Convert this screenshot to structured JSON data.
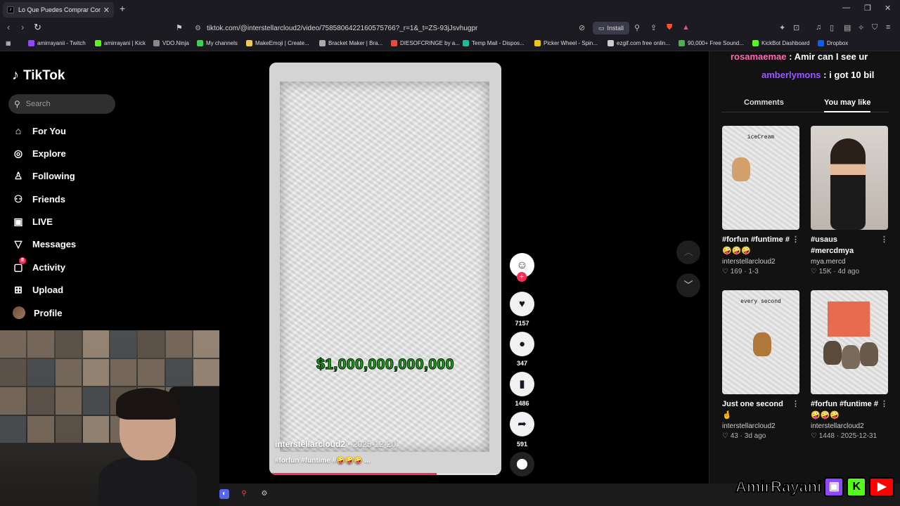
{
  "browser": {
    "tab_title": "Lo Que Puedes Comprar Con",
    "url": "tiktok.com/@interstellarcloud2/video/7585806422160575766?_r=1&_t=ZS-93jJsvhugpr",
    "install_label": "Install",
    "bookmarks": [
      {
        "label": "amirrayanii - Twitch",
        "color": "#9146ff"
      },
      {
        "label": "amirrayani | Kick",
        "color": "#53fc18"
      },
      {
        "label": "VDO.Ninja",
        "color": "#888888"
      },
      {
        "label": "My channels",
        "color": "#39d353"
      },
      {
        "label": "MakeEmoji | Create...",
        "color": "#f2c94c"
      },
      {
        "label": "Bracket Maker | Bra...",
        "color": "#aaaaaa"
      },
      {
        "label": "DIESOFCRINGE by a...",
        "color": "#e74c3c"
      },
      {
        "label": "Temp Mail - Dispos...",
        "color": "#1abc9c"
      },
      {
        "label": "Picker Wheel - Spin...",
        "color": "#f1c40f"
      },
      {
        "label": "ezgif.com free onlin...",
        "color": "#cccccc"
      },
      {
        "label": "90,000+ Free Sound...",
        "color": "#4caf50"
      },
      {
        "label": "KickBot Dashboard",
        "color": "#53fc18"
      },
      {
        "label": "Dropbox",
        "color": "#0061ff"
      }
    ]
  },
  "tiktok": {
    "logo_text": "TikTok",
    "search_placeholder": "Search",
    "nav": [
      {
        "label": "For You",
        "icon": "home-icon",
        "glyph": "⌂"
      },
      {
        "label": "Explore",
        "icon": "compass-icon",
        "glyph": "◎"
      },
      {
        "label": "Following",
        "icon": "user-follow-icon",
        "glyph": "♙"
      },
      {
        "label": "Friends",
        "icon": "friends-icon",
        "glyph": "⚇"
      },
      {
        "label": "LIVE",
        "icon": "live-icon",
        "glyph": "▣"
      },
      {
        "label": "Messages",
        "icon": "messages-icon",
        "glyph": "▽"
      },
      {
        "label": "Activity",
        "icon": "activity-icon",
        "glyph": "▢",
        "badge": "8"
      },
      {
        "label": "Upload",
        "icon": "upload-icon",
        "glyph": "⊞"
      },
      {
        "label": "Profile",
        "icon": "profile-avatar",
        "glyph": ""
      }
    ]
  },
  "video": {
    "overlay_text": "$1,000,000,000,000",
    "author": "interstellarcloud2",
    "date": "2025-12-20",
    "caption": "#forfun #funtime #🤪🤪🤪 ...",
    "progress": 0.72,
    "likes": "7157",
    "comments": "347",
    "saves": "1486",
    "shares": "591"
  },
  "side": {
    "chat": [
      {
        "name": "rosamaemae",
        "text": ": Amir can I see ur"
      },
      {
        "name": "amberlymons",
        "text": ": i got 10 bil"
      }
    ],
    "tabs": [
      "Comments",
      "You may like"
    ],
    "active_tab": "You may like",
    "cards": [
      {
        "title": "#forfun #funtime #🤪🤪🤪",
        "author": "interstellarcloud2",
        "likes": "169",
        "date": "1-3",
        "thumb_text": "iceCream"
      },
      {
        "title": "#usaus #mercdmya",
        "author": "mya.mercd",
        "likes": "15K",
        "date": "4d ago",
        "thumb_text": ""
      },
      {
        "title": "Just one second 🤞",
        "author": "interstellarcloud2",
        "likes": "43",
        "date": "3d ago",
        "thumb_text": "every second"
      },
      {
        "title": "#forfun #funtime #🤪🤪🤪",
        "author": "interstellarcloud2",
        "likes": "1448",
        "date": "2025-12-31",
        "thumb_text": ""
      }
    ]
  },
  "branding": {
    "name": "AmirRayani",
    "colors": {
      "twitch": "#9146ff",
      "kick": "#53fc18",
      "youtube": "#ff0000"
    }
  }
}
